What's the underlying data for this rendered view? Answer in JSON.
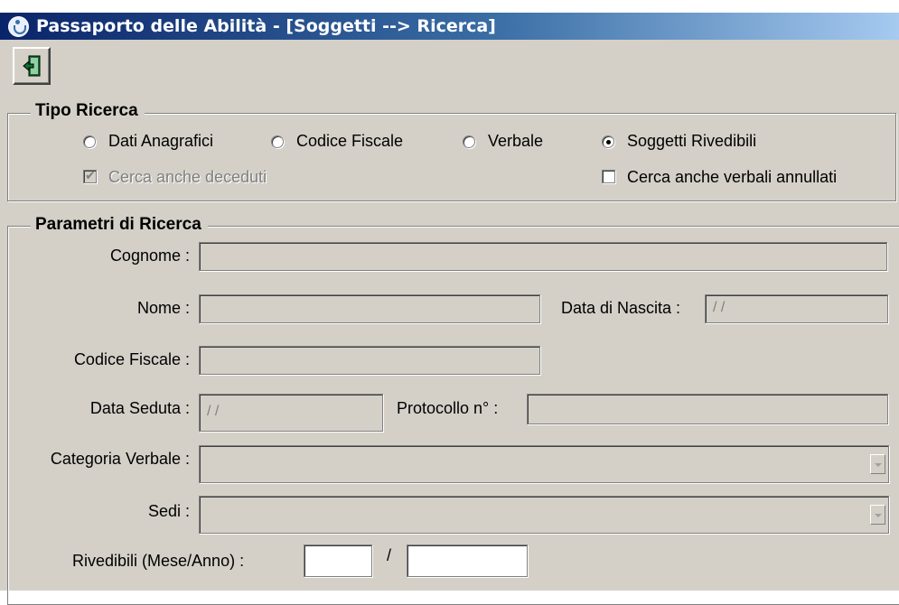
{
  "window": {
    "title": "Passaporto delle Abilità - [Soggetti --> Ricerca]"
  },
  "toolbar": {
    "exit_icon": "exit-door-icon"
  },
  "tipo_ricerca": {
    "legend": "Tipo Ricerca",
    "options": [
      {
        "label": "Dati Anagrafici",
        "selected": false
      },
      {
        "label": "Codice Fiscale",
        "selected": false
      },
      {
        "label": "Verbale",
        "selected": false
      },
      {
        "label": "Soggetti Rivedibili",
        "selected": true
      }
    ],
    "cerca_deceduti": {
      "label": "Cerca anche deceduti",
      "checked": true,
      "enabled": false
    },
    "cerca_annullati": {
      "label": "Cerca anche verbali annullati",
      "checked": false,
      "enabled": true
    }
  },
  "parametri": {
    "legend": "Parametri di Ricerca",
    "cognome": {
      "label": "Cognome :",
      "value": ""
    },
    "nome": {
      "label": "Nome :",
      "value": ""
    },
    "data_nascita": {
      "label": "Data di Nascita :",
      "value": "/ /"
    },
    "codice_fiscale": {
      "label": "Codice Fiscale :",
      "value": ""
    },
    "data_seduta": {
      "label": "Data Seduta :",
      "value": "/ /"
    },
    "protocollo": {
      "label": "Protocollo n° :",
      "value": ""
    },
    "categoria_verbale": {
      "label": "Categoria Verbale :",
      "value": ""
    },
    "sedi": {
      "label": "Sedi :",
      "value": ""
    },
    "rivedibili": {
      "label": "Rivedibili (Mese/Anno) :",
      "separator": "/",
      "mese": "",
      "anno": ""
    }
  },
  "colors": {
    "face": "#d4d0c8",
    "title_start": "#0a246a",
    "title_end": "#a6caf0"
  }
}
